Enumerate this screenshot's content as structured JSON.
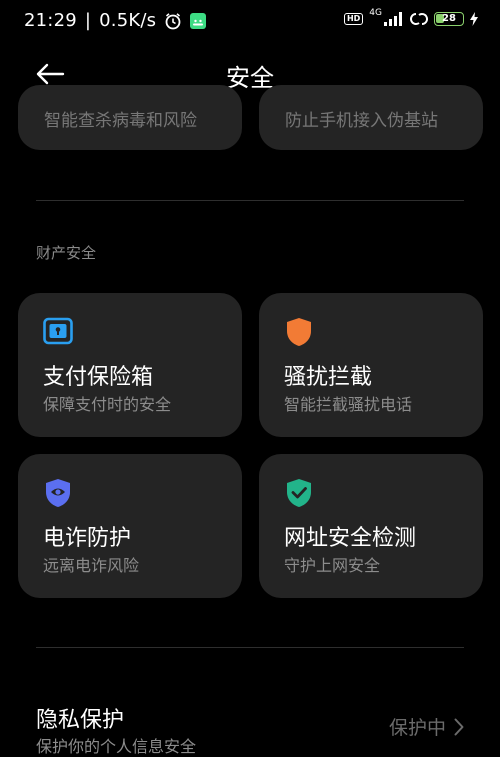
{
  "status_bar": {
    "time": "21:29",
    "net_speed": "0.5K/s",
    "hd_label": "HD",
    "network_type": "4G",
    "battery_level": "28"
  },
  "header": {
    "title": "安全"
  },
  "top_cards": [
    {
      "desc": "智能查杀病毒和风险"
    },
    {
      "desc": "防止手机接入伪基站"
    }
  ],
  "section": {
    "title": "财产安全"
  },
  "cards": [
    {
      "title": "支付保险箱",
      "desc": "保障支付时的安全",
      "icon": "safe-box-icon",
      "color": "#2a9ff0"
    },
    {
      "title": "骚扰拦截",
      "desc": "智能拦截骚扰电话",
      "icon": "shield-icon",
      "color": "#f27b35"
    },
    {
      "title": "电诈防护",
      "desc": "远离电诈风险",
      "icon": "eye-shield-icon",
      "color": "#5b6ff0"
    },
    {
      "title": "网址安全检测",
      "desc": "守护上网安全",
      "icon": "check-shield-icon",
      "color": "#22b48a"
    }
  ],
  "privacy": {
    "title": "隐私保护",
    "desc": "保护你的个人信息安全",
    "status": "保护中"
  }
}
